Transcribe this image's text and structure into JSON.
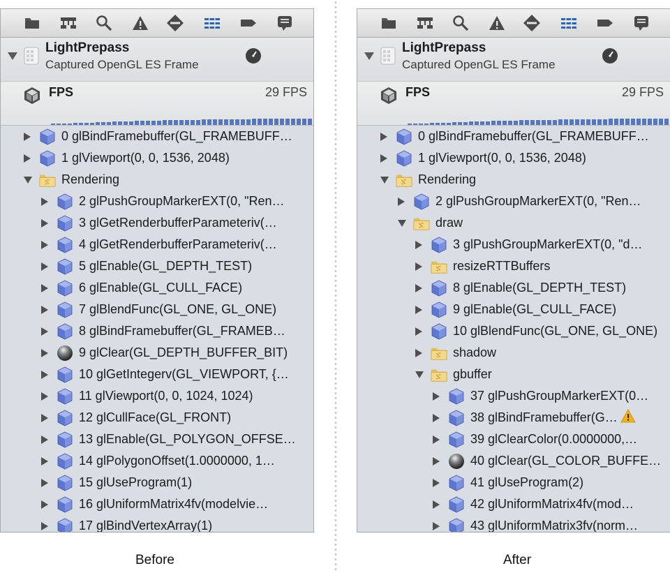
{
  "captions": {
    "before": "Before",
    "after": "After"
  },
  "colors": {
    "panel_bg": "#d9dde4",
    "cube": "#6f86d6",
    "folder": "#f0d281",
    "warn": "#f2b21b",
    "selected_tab": "#2f63b5"
  },
  "toolbar_icons": [
    "folder-icon",
    "hierarchy-icon",
    "search-icon",
    "warning-icon",
    "breakpoint-icon",
    "list-icon",
    "tag-icon",
    "comment-icon"
  ],
  "before": {
    "frame": {
      "title": "LightPrepass",
      "subtitle": "Captured OpenGL ES Frame"
    },
    "fps": {
      "label": "FPS",
      "value": "29 FPS"
    },
    "rows": [
      {
        "indent": 0,
        "tri": "closed",
        "icon": "cube",
        "label": "0 glBindFramebuffer(GL_FRAMEBUFF…"
      },
      {
        "indent": 0,
        "tri": "closed",
        "icon": "cube",
        "label": "1 glViewport(0, 0, 1536, 2048)"
      },
      {
        "indent": 0,
        "tri": "open",
        "icon": "folder",
        "label": "Rendering"
      },
      {
        "indent": 1,
        "tri": "closed",
        "icon": "cube",
        "label": "2 glPushGroupMarkerEXT(0, \"Ren…"
      },
      {
        "indent": 1,
        "tri": "closed",
        "icon": "cube",
        "label": "3 glGetRenderbufferParameteriv(…"
      },
      {
        "indent": 1,
        "tri": "closed",
        "icon": "cube",
        "label": "4 glGetRenderbufferParameteriv(…"
      },
      {
        "indent": 1,
        "tri": "closed",
        "icon": "cube",
        "label": "5 glEnable(GL_DEPTH_TEST)"
      },
      {
        "indent": 1,
        "tri": "closed",
        "icon": "cube",
        "label": "6 glEnable(GL_CULL_FACE)"
      },
      {
        "indent": 1,
        "tri": "closed",
        "icon": "cube",
        "label": "7 glBlendFunc(GL_ONE, GL_ONE)"
      },
      {
        "indent": 1,
        "tri": "closed",
        "icon": "cube",
        "label": "8 glBindFramebuffer(GL_FRAMEB…"
      },
      {
        "indent": 1,
        "tri": "closed",
        "icon": "sphere",
        "label": "9 glClear(GL_DEPTH_BUFFER_BIT)"
      },
      {
        "indent": 1,
        "tri": "closed",
        "icon": "cube",
        "label": "10 glGetIntegerv(GL_VIEWPORT, {…"
      },
      {
        "indent": 1,
        "tri": "closed",
        "icon": "cube",
        "label": "11 glViewport(0, 0, 1024, 1024)"
      },
      {
        "indent": 1,
        "tri": "closed",
        "icon": "cube",
        "label": "12 glCullFace(GL_FRONT)"
      },
      {
        "indent": 1,
        "tri": "closed",
        "icon": "cube",
        "label": "13 glEnable(GL_POLYGON_OFFSE…"
      },
      {
        "indent": 1,
        "tri": "closed",
        "icon": "cube",
        "label": "14 glPolygonOffset(1.0000000, 1…"
      },
      {
        "indent": 1,
        "tri": "closed",
        "icon": "cube",
        "label": "15 glUseProgram(1)"
      },
      {
        "indent": 1,
        "tri": "closed",
        "icon": "cube",
        "label": "16 glUniformMatrix4fv(modelvie…"
      },
      {
        "indent": 1,
        "tri": "closed",
        "icon": "cube",
        "label": "17 glBindVertexArray(1)"
      }
    ]
  },
  "after": {
    "frame": {
      "title": "LightPrepass",
      "subtitle": "Captured OpenGL ES Frame"
    },
    "fps": {
      "label": "FPS",
      "value": "29 FPS"
    },
    "rows": [
      {
        "indent": 0,
        "tri": "closed",
        "icon": "cube",
        "label": "0 glBindFramebuffer(GL_FRAMEBUFF…"
      },
      {
        "indent": 0,
        "tri": "closed",
        "icon": "cube",
        "label": "1 glViewport(0, 0, 1536, 2048)"
      },
      {
        "indent": 0,
        "tri": "open",
        "icon": "folder",
        "label": "Rendering"
      },
      {
        "indent": 1,
        "tri": "closed",
        "icon": "cube",
        "label": "2 glPushGroupMarkerEXT(0, \"Ren…"
      },
      {
        "indent": 1,
        "tri": "open",
        "icon": "folder",
        "label": "draw"
      },
      {
        "indent": 2,
        "tri": "closed",
        "icon": "cube",
        "label": "3 glPushGroupMarkerEXT(0, \"d…"
      },
      {
        "indent": 2,
        "tri": "closed",
        "icon": "folder",
        "label": "resizeRTTBuffers"
      },
      {
        "indent": 2,
        "tri": "closed",
        "icon": "cube",
        "label": "8 glEnable(GL_DEPTH_TEST)"
      },
      {
        "indent": 2,
        "tri": "closed",
        "icon": "cube",
        "label": "9 glEnable(GL_CULL_FACE)"
      },
      {
        "indent": 2,
        "tri": "closed",
        "icon": "cube",
        "label": "10 glBlendFunc(GL_ONE, GL_ONE)"
      },
      {
        "indent": 2,
        "tri": "closed",
        "icon": "folder",
        "label": "shadow"
      },
      {
        "indent": 2,
        "tri": "open",
        "icon": "folder",
        "label": "gbuffer"
      },
      {
        "indent": 3,
        "tri": "closed",
        "icon": "cube",
        "label": "37 glPushGroupMarkerEXT(0…"
      },
      {
        "indent": 3,
        "tri": "closed",
        "icon": "cube",
        "label": "38 glBindFramebuffer(G…",
        "warning": true
      },
      {
        "indent": 3,
        "tri": "closed",
        "icon": "cube",
        "label": "39 glClearColor(0.0000000,…"
      },
      {
        "indent": 3,
        "tri": "closed",
        "icon": "sphere",
        "label": "40 glClear(GL_COLOR_BUFFE…"
      },
      {
        "indent": 3,
        "tri": "closed",
        "icon": "cube",
        "label": "41 glUseProgram(2)"
      },
      {
        "indent": 3,
        "tri": "closed",
        "icon": "cube",
        "label": "42 glUniformMatrix4fv(mod…"
      },
      {
        "indent": 3,
        "tri": "closed",
        "icon": "cube",
        "label": "43 glUniformMatrix3fv(norm…"
      }
    ]
  }
}
